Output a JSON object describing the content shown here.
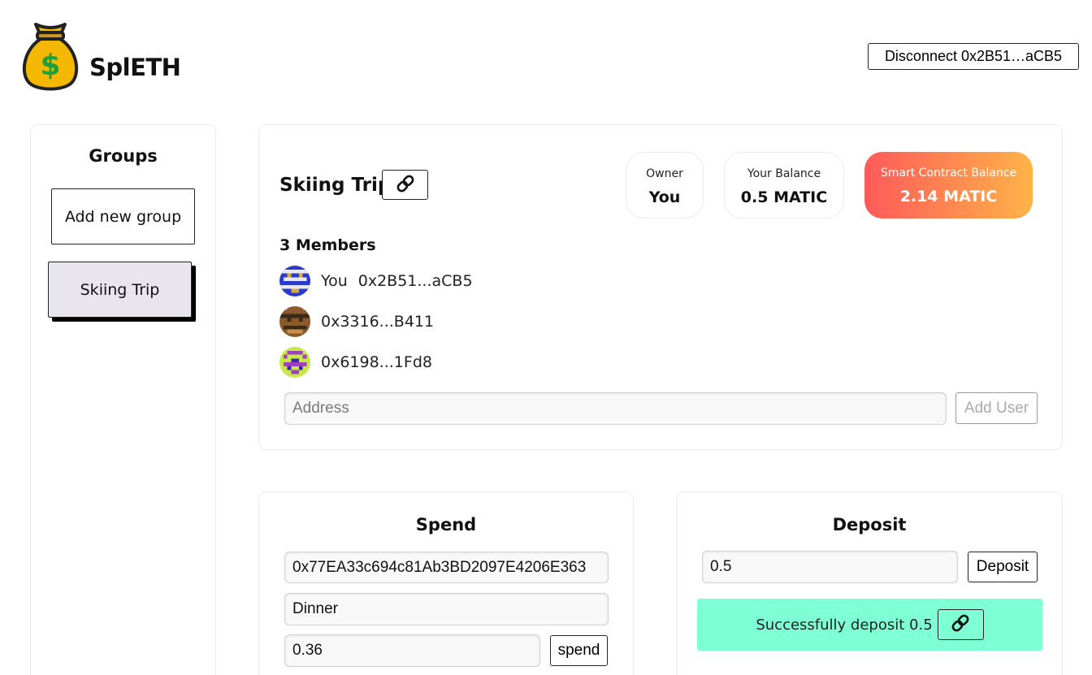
{
  "header": {
    "app_title": "SplETH",
    "logo_icon": "money-bag-icon",
    "disconnect_label": "Disconnect 0x2B51…aCB5"
  },
  "sidebar": {
    "title": "Groups",
    "add_group_label": "Add new group",
    "groups": [
      {
        "label": "Skiing Trip",
        "selected": true
      }
    ]
  },
  "group": {
    "title": "Skiing Trip",
    "share_icon": "link-icon",
    "stats": {
      "owner_label": "Owner",
      "owner_value": "You",
      "balance_label": "Your Balance",
      "balance_value": "0.5 MATIC",
      "contract_label": "Smart Contract Balance",
      "contract_value": "2.14 MATIC"
    },
    "members_title": "3 Members",
    "members": [
      {
        "you_label": "You",
        "address": "0x2B51...aCB5"
      },
      {
        "address": "0x3316...B411"
      },
      {
        "address": "0x6198...1Fd8"
      }
    ],
    "address_placeholder": "Address",
    "add_user_label": "Add User"
  },
  "spend": {
    "title": "Spend",
    "to_address": "0x77EA33c694c81Ab3BD2097E4206E363",
    "description": "Dinner",
    "amount": "0.36",
    "button_label": "spend"
  },
  "deposit": {
    "title": "Deposit",
    "amount": "0.5",
    "button_label": "Deposit",
    "success_message": "Successfully deposit 0.5",
    "success_color": "#7fffd4"
  },
  "colors": {
    "gradient_start": "#ff5a5a",
    "gradient_end": "#ffb347",
    "selected_group_bg": "#e8e5ef"
  }
}
